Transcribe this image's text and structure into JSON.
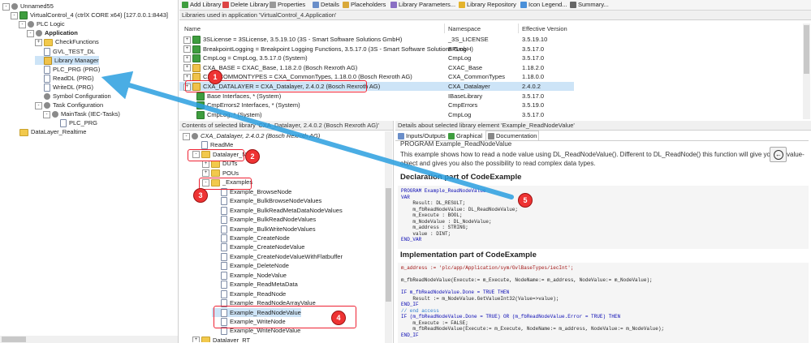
{
  "left_tree": [
    {
      "label": "Unnamed55",
      "indent": 0,
      "icon": "project-icon",
      "pm": "-"
    },
    {
      "label": "VirtualControl_4 (ctrlX CORE x64) [127.0.0.1:8443]",
      "indent": 1,
      "icon": "device-icon",
      "pm": "-"
    },
    {
      "label": "PLC Logic",
      "indent": 2,
      "icon": "gear-icon",
      "pm": "-"
    },
    {
      "label": "Application",
      "indent": 3,
      "icon": "gear-icon",
      "pm": "-",
      "bold": true
    },
    {
      "label": "CheckFunctions",
      "indent": 4,
      "icon": "folder-icon",
      "pm": "+"
    },
    {
      "label": "GVL_TEST_DL",
      "indent": 4,
      "icon": "doc-icon"
    },
    {
      "label": "Library Manager",
      "indent": 4,
      "icon": "library-icon",
      "selected": true
    },
    {
      "label": "PLC_PRG (PRG)",
      "indent": 4,
      "icon": "doc-icon"
    },
    {
      "label": "ReadDL (PRG)",
      "indent": 4,
      "icon": "doc-icon"
    },
    {
      "label": "WriteDL (PRG)",
      "indent": 4,
      "icon": "doc-icon"
    },
    {
      "label": "Symbol Configuration",
      "indent": 4,
      "icon": "gear-icon"
    },
    {
      "label": "Task Configuration",
      "indent": 4,
      "icon": "task-icon",
      "pm": "-"
    },
    {
      "label": "MainTask (IEC-Tasks)",
      "indent": 5,
      "icon": "gear-icon",
      "pm": "-"
    },
    {
      "label": "PLC_PRG",
      "indent": 6,
      "icon": "doc-icon"
    },
    {
      "label": "DataLayer_Realtime",
      "indent": 1,
      "icon": "folder-icon"
    }
  ],
  "toolbar": [
    {
      "label": "Add Library",
      "icon": "add-library-icon"
    },
    {
      "label": "Delete Library",
      "icon": "delete-icon"
    },
    {
      "label": "Properties",
      "icon": "properties-icon"
    },
    {
      "label": "Details",
      "icon": "details-icon"
    },
    {
      "label": "Placeholders",
      "icon": "placeholders-icon"
    },
    {
      "label": "Library Parameters...",
      "icon": "parameters-icon"
    },
    {
      "label": "Library Repository",
      "icon": "repository-icon"
    },
    {
      "label": "Icon Legend...",
      "icon": "info-icon"
    },
    {
      "label": "Summary...",
      "icon": "summary-icon"
    }
  ],
  "libs_header": "Libraries used in application 'VirtualControl_4.Application'",
  "libs_columns": {
    "name": "Name",
    "namespace": "Namespace",
    "version": "Effective Version"
  },
  "libs": [
    {
      "name": "3SLicense = 3SLicense, 3.5.19.10 (3S - Smart Software Solutions GmbH)",
      "ns": "_3S_LICENSE",
      "ver": "3.5.19.10",
      "indent": 0,
      "icon": "green"
    },
    {
      "name": "BreakpointLogging = Breakpoint Logging Functions, 3.5.17.0 (3S - Smart Software Solutions GmbH)",
      "ns": "BPLog",
      "ver": "3.5.17.0",
      "indent": 0,
      "icon": "green"
    },
    {
      "name": "CmpLog = CmpLog, 3.5.17.0 (System)",
      "ns": "CmpLog",
      "ver": "3.5.17.0",
      "indent": 0,
      "icon": "green"
    },
    {
      "name": "CXA_BASE = CXAC_Base, 1.18.2.0 (Bosch Rexroth AG)",
      "ns": "CXAC_Base",
      "ver": "1.18.2.0",
      "indent": 0,
      "icon": "lib"
    },
    {
      "name": "CXA_COMMONTYPES = CXA_CommonTypes, 1.18.0.0 (Bosch Rexroth AG)",
      "ns": "CXA_CommonTypes",
      "ver": "1.18.0.0",
      "indent": 0,
      "icon": "lib"
    },
    {
      "name": "CXA_DATALAYER = CXA_Datalayer, 2.4.0.2 (Bosch Rexroth AG)",
      "ns": "CXA_Datalayer",
      "ver": "2.4.0.2",
      "indent": 0,
      "icon": "lib",
      "selected": true
    },
    {
      "name": "Base Interfaces, * (System)",
      "ns": "IBaseLibrary",
      "ver": "3.5.17.0",
      "indent": 1,
      "icon": "green"
    },
    {
      "name": "CmpErrors2 Interfaces, * (System)",
      "ns": "CmpErrors",
      "ver": "3.5.19.0",
      "indent": 1,
      "icon": "green"
    },
    {
      "name": "CmpLog, * (System)",
      "ns": "CmpLog",
      "ver": "3.5.17.0",
      "indent": 1,
      "icon": "green"
    }
  ],
  "contents_header": "Contents of selected library 'CXA_Datalayer, 2.4.0.2 (Bosch Rexroth AG)'",
  "contents_tree": [
    {
      "label": "CXA_Datalayer, 2.4.0.2 (Bosch Rexroth AG)",
      "indent": 0,
      "icon": "gear",
      "pm": "-",
      "italic": true
    },
    {
      "label": "ReadMe",
      "indent": 1,
      "icon": "doc"
    },
    {
      "label": "Datalayer_NRT",
      "indent": 1,
      "icon": "folder",
      "pm": "-"
    },
    {
      "label": "DUTs",
      "indent": 2,
      "icon": "folder",
      "pm": "+"
    },
    {
      "label": "POUs",
      "indent": 2,
      "icon": "folder",
      "pm": "+"
    },
    {
      "label": "_Examples",
      "indent": 2,
      "icon": "folder",
      "pm": "-"
    },
    {
      "label": "Example_BrowseNode",
      "indent": 3,
      "icon": "doc"
    },
    {
      "label": "Example_BulkBrowseNodeValues",
      "indent": 3,
      "icon": "doc"
    },
    {
      "label": "Example_BulkReadMetaDataNodeValues",
      "indent": 3,
      "icon": "doc"
    },
    {
      "label": "Example_BulkReadNodeValues",
      "indent": 3,
      "icon": "doc"
    },
    {
      "label": "Example_BulkWriteNodeValues",
      "indent": 3,
      "icon": "doc"
    },
    {
      "label": "Example_CreateNode",
      "indent": 3,
      "icon": "doc"
    },
    {
      "label": "Example_CreateNodeValue",
      "indent": 3,
      "icon": "doc"
    },
    {
      "label": "Example_CreateNodeValueWithFlatbuffer",
      "indent": 3,
      "icon": "doc"
    },
    {
      "label": "Example_DeleteNode",
      "indent": 3,
      "icon": "doc"
    },
    {
      "label": "Example_NodeValue",
      "indent": 3,
      "icon": "doc"
    },
    {
      "label": "Example_ReadMetaData",
      "indent": 3,
      "icon": "doc"
    },
    {
      "label": "Example_ReadNode",
      "indent": 3,
      "icon": "doc"
    },
    {
      "label": "Example_ReadNodeArrayValue",
      "indent": 3,
      "icon": "doc"
    },
    {
      "label": "Example_ReadNodeValue",
      "indent": 3,
      "icon": "doc",
      "selected": true
    },
    {
      "label": "Example_WriteNode",
      "indent": 3,
      "icon": "doc"
    },
    {
      "label": "Example_WriteNodeValue",
      "indent": 3,
      "icon": "doc"
    },
    {
      "label": "Datalayer_RT",
      "indent": 1,
      "icon": "folder",
      "pm": "+"
    }
  ],
  "details_header": "Details about selected library element 'Example_ReadNodeValue'",
  "details_tabs": [
    {
      "label": "Inputs/Outputs",
      "icon": "io-icon"
    },
    {
      "label": "Graphical",
      "icon": "graphical-icon"
    },
    {
      "label": "Documentation",
      "icon": "documentation-icon",
      "active": true
    }
  ],
  "doc": {
    "title": "PROGRAM Example_ReadNodeValue",
    "desc1": "This example shows how to read a node value using DL_ReadNodeValue(). Different to DL_ReadNode() this function will give you a",
    "desc1b": "value-",
    "desc2": "object and gives you also the possibility to read complex data types.",
    "decl_heading": "Declaration part of CodeExample",
    "decl_code": [
      "PROGRAM Example_ReadNodeValue",
      "VAR",
      "    Result: DL_RESULT;",
      "    m_fbReadNodeValue: DL_ReadNodeValue;",
      "    m_Execute : BOOL;",
      "    m_NodeValue : DL_NodeValue;",
      "    m_address : STRING;",
      "    value : DINT;",
      "END_VAR"
    ],
    "impl_heading": "Implementation part of CodeExample",
    "impl_code": [
      "m_address := 'plc/app/Application/sym/GvlBaseTypes/iecInt';",
      "",
      "m_fbReadNodeValue(Execute:= m_Execute, NodeName:= m_address, NodeValue:= m_NodeValue);",
      "",
      "IF m_fbReadNodeValue.Done = TRUE THEN",
      "    Result := m_NodeValue.GetValueInt32(Value=>value);",
      "END_IF",
      "// end access",
      "IF (m_fbReadNodeValue.Done = TRUE) OR (m_fbReadNodeValue.Error = TRUE) THEN",
      "    m_Execute := FALSE;",
      "    m_fbReadNodeValue(Execute:= m_Execute, NodeName:= m_address, NodeValue:= m_NodeValue);",
      "END_IF"
    ]
  },
  "badges": [
    "1",
    "2",
    "3",
    "4",
    "5"
  ],
  "colors": {
    "accent": "#e23333",
    "arrow": "#2b9fe0",
    "selection": "#cde4f7"
  }
}
